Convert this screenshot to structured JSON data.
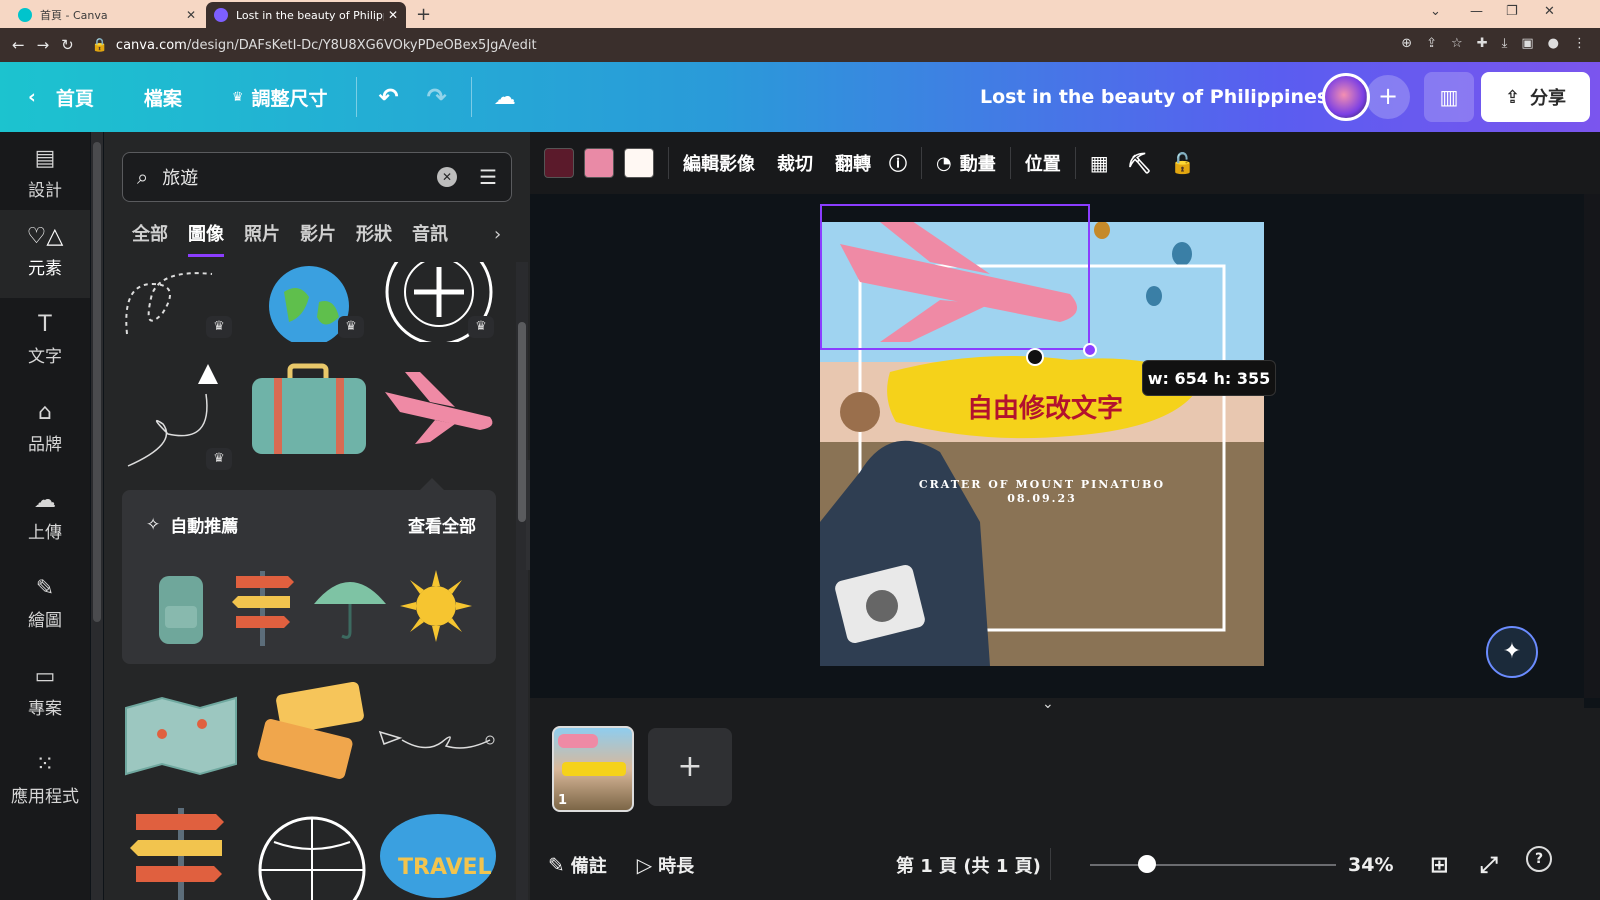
{
  "browser": {
    "tabs": [
      {
        "title": "首頁 - Canva"
      },
      {
        "title": "Lost in the beauty of Philippine"
      }
    ],
    "url_host": "canva.com",
    "url_path": "/design/DAFsKetI-Dc/Y8U8XG6VOkyPDeOBex5JgA/edit"
  },
  "topbar": {
    "home": "首頁",
    "file": "檔案",
    "resize": "調整尺寸",
    "design_title": "Lost in the beauty of Philippines",
    "share": "分享"
  },
  "left_rail": {
    "items": [
      {
        "label": "設計",
        "icon": "layout-icon"
      },
      {
        "label": "元素",
        "icon": "shapes-icon"
      },
      {
        "label": "文字",
        "icon": "text-icon"
      },
      {
        "label": "品牌",
        "icon": "brand-icon"
      },
      {
        "label": "上傳",
        "icon": "upload-icon"
      },
      {
        "label": "繪圖",
        "icon": "draw-icon"
      },
      {
        "label": "專案",
        "icon": "folder-icon"
      },
      {
        "label": "應用程式",
        "icon": "apps-icon"
      }
    ]
  },
  "panel": {
    "search_value": "旅遊",
    "categories": [
      "全部",
      "圖像",
      "照片",
      "影片",
      "形狀",
      "音訊"
    ],
    "auto_title": "自動推薦",
    "see_all": "查看全部"
  },
  "context_toolbar": {
    "colors": [
      "#5b1a2b",
      "#e98aa6",
      "#fff8f3"
    ],
    "edit_image": "編輯影像",
    "crop": "裁切",
    "flip": "翻轉",
    "animate": "動畫",
    "position": "位置"
  },
  "design": {
    "headline": "自由修改文字",
    "subtitle": "CRATER OF MOUNT PINATUBO",
    "date": "08.09.23",
    "size_tooltip": "w: 654 h: 355"
  },
  "pages": {
    "page_number": "1"
  },
  "bottom": {
    "notes": "備註",
    "duration": "時長",
    "page_indicator": "第 1 頁 (共 1 頁)",
    "zoom": "34%",
    "zoom_level": 0.34
  }
}
